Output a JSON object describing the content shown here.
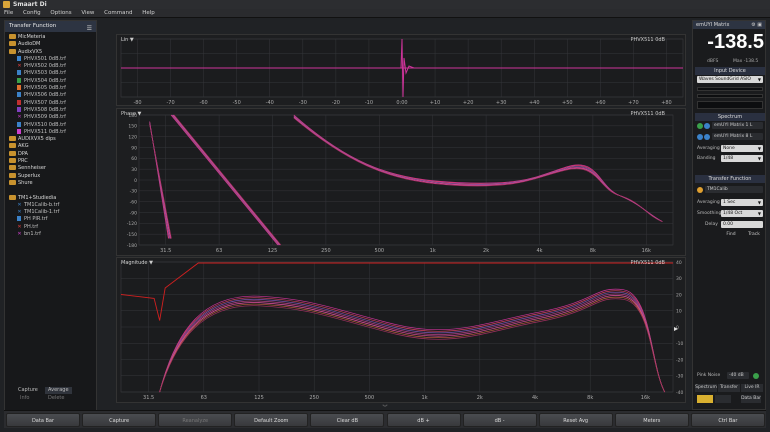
{
  "app": {
    "title": "Smaart Di"
  },
  "menu": [
    "File",
    "Config",
    "Options",
    "View",
    "Command",
    "Help"
  ],
  "left": {
    "title": "Transfer Function",
    "tree": [
      {
        "type": "folder",
        "label": "MicMeteria",
        "indent": 0
      },
      {
        "type": "folder",
        "label": "AudioDM",
        "indent": 0
      },
      {
        "type": "folder",
        "label": "AudixVX5",
        "indent": 0
      },
      {
        "type": "file",
        "label": "PHVX501 0dB.trf",
        "color": "#3b82c9",
        "indent": 1
      },
      {
        "type": "x",
        "label": "PHVX502 0dB.trf",
        "color": "#e04040",
        "indent": 1
      },
      {
        "type": "file",
        "label": "PHVX503 0dB.trf",
        "color": "#3b82c9",
        "indent": 1
      },
      {
        "type": "file",
        "label": "PHVX504 0dB.trf",
        "color": "#3aa04a",
        "indent": 1
      },
      {
        "type": "file",
        "label": "PHVX505 0dB.trf",
        "color": "#e07030",
        "indent": 1
      },
      {
        "type": "file",
        "label": "PHVX506 0dB.trf",
        "color": "#3b82c9",
        "indent": 1
      },
      {
        "type": "file",
        "label": "PHVX507 0dB.trf",
        "color": "#c03030",
        "indent": 1
      },
      {
        "type": "file",
        "label": "PHVX508 0dB.trf",
        "color": "#8040c0",
        "indent": 1
      },
      {
        "type": "x",
        "label": "PHVX509 0dB.trf",
        "color": "#cc40cc",
        "indent": 1
      },
      {
        "type": "file",
        "label": "PHVX510 0dB.trf",
        "color": "#3b82c9",
        "indent": 1
      },
      {
        "type": "file",
        "label": "PHVX511 0dB.trf",
        "color": "#cc40cc",
        "indent": 1
      },
      {
        "type": "folder",
        "label": "AUDIXVX5 dips",
        "indent": 0
      },
      {
        "type": "folder",
        "label": "AKG",
        "indent": 0
      },
      {
        "type": "folder",
        "label": "DPA",
        "indent": 0
      },
      {
        "type": "folder",
        "label": "PRC",
        "indent": 0
      },
      {
        "type": "folder",
        "label": "Sennheiser",
        "indent": 0
      },
      {
        "type": "folder",
        "label": "Superlux",
        "indent": 0
      },
      {
        "type": "folder",
        "label": "Shure",
        "indent": 0
      },
      {
        "type": "spacer",
        "label": "",
        "indent": 0
      },
      {
        "type": "folder",
        "label": "TM1+Studiedia",
        "indent": 0
      },
      {
        "type": "x",
        "label": "TM1Calib-b.trf",
        "color": "#3b82c9",
        "indent": 1
      },
      {
        "type": "x",
        "label": "TM1Calib-1.trf",
        "color": "#3b82c9",
        "indent": 1
      },
      {
        "type": "file",
        "label": "PH PIR.trf",
        "color": "#3b82c9",
        "indent": 1
      },
      {
        "type": "x",
        "label": "PH.trf",
        "color": "#e04040",
        "indent": 1
      },
      {
        "type": "x",
        "label": "bn1.trf",
        "color": "#cc40cc",
        "indent": 1
      }
    ],
    "tabs": [
      "Capture",
      "Average",
      "Info",
      "Delete"
    ]
  },
  "plots": {
    "ir": {
      "label": "Lin ▼",
      "file": "PHVX511 0dB"
    },
    "phase": {
      "label": "Phase ▼",
      "file": "PHVX511 0dB"
    },
    "magnitude": {
      "label": "Magnitude ▼",
      "file": "PHVX511 0dB"
    }
  },
  "chart_data": [
    {
      "type": "line",
      "title": "Lin",
      "x_ticks": [
        "-80",
        "-70",
        "-60",
        "-50",
        "-40",
        "-30",
        "-20",
        "-10",
        "0:00",
        "+10",
        "+20",
        "+30",
        "+40",
        "+50",
        "+60",
        "+70",
        "+80"
      ],
      "y_ticks": [],
      "grid": true
    },
    {
      "type": "line",
      "title": "Phase",
      "x_ticks": [
        "31.5",
        "63",
        "125",
        "250",
        "500",
        "1k",
        "2k",
        "4k",
        "8k",
        "16k"
      ],
      "y_ticks": [
        "180",
        "150",
        "120",
        "90",
        "60",
        "30",
        "0",
        "-30",
        "-60",
        "-90",
        "-120",
        "-150",
        "-180"
      ],
      "grid": true
    },
    {
      "type": "line",
      "title": "Magnitude",
      "x_ticks": [
        "31.5",
        "63",
        "125",
        "250",
        "500",
        "1k",
        "2k",
        "4k",
        "8k",
        "16k"
      ],
      "y_ticks_right": [
        "40",
        "30",
        "20",
        "10",
        "0",
        "-10",
        "-20",
        "-30",
        "-40"
      ],
      "grid": true
    }
  ],
  "right": {
    "device_header": "emUYI Matrix",
    "header_icons": "⚙ ▣",
    "level": "-138.5",
    "level_unit": "dBFS",
    "level_max": "Max -138.5",
    "input_device_title": "Input Device",
    "input_device": "Waves SoundGrid ASIO",
    "spectrum_title": "Spectrum",
    "spectrum_ch1": "emUYI Matrix 1 L",
    "spectrum_ch2": "emUYI Matrix 8 L",
    "averaging_label": "Averaging",
    "spectrum_averaging": "None",
    "banding_label": "Banding",
    "banding": "1/48",
    "tf_title": "Transfer Function",
    "tf_channel": "TM1Calib",
    "tf_averaging": "1 Sec",
    "smoothing_label": "Smoothing",
    "smoothing": "1/48 Oct",
    "delay_label": "Delay",
    "delay": "0.00",
    "find_label": "Find",
    "track_label": "Track",
    "pink_noise_label": "Pink Noise",
    "pink_noise_level": "-40 dB",
    "view_tabs": [
      "Spectrum",
      "Transfer",
      "Live IR"
    ],
    "data_bar_label": "Data Bar"
  },
  "bottom_buttons": [
    {
      "label": "Data Bar",
      "dim": false
    },
    {
      "label": "Capture",
      "dim": false
    },
    {
      "label": "Reanalyze",
      "dim": true
    },
    {
      "label": "Default Zoom",
      "dim": false
    },
    {
      "label": "Clear dB",
      "dim": false
    },
    {
      "label": "dB +",
      "dim": false
    },
    {
      "label": "dB -",
      "dim": false
    },
    {
      "label": "Reset Avg",
      "dim": false
    },
    {
      "label": "Meters",
      "dim": false
    },
    {
      "label": "Ctrl Bar",
      "dim": false
    }
  ],
  "colors": {
    "trace_primary": "#cc3399",
    "trace_secondary": "#d04060",
    "trace_tertiary": "#7a55b0",
    "trace_reference": "#d02020",
    "grid": "#35363a"
  }
}
